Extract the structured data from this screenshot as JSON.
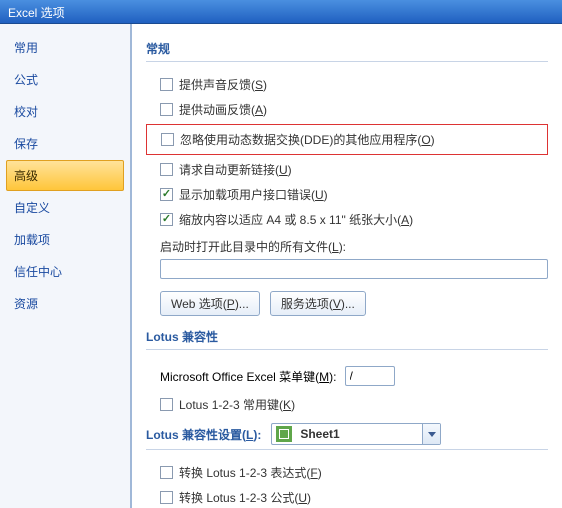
{
  "window": {
    "title": "Excel 选项"
  },
  "sidebar": {
    "items": [
      {
        "label": "常用"
      },
      {
        "label": "公式"
      },
      {
        "label": "校对"
      },
      {
        "label": "保存"
      },
      {
        "label": "高级"
      },
      {
        "label": "自定义"
      },
      {
        "label": "加载项"
      },
      {
        "label": "信任中心"
      },
      {
        "label": "资源"
      }
    ]
  },
  "general": {
    "title": "常规",
    "sound_feedback": {
      "label": "提供声音反馈(",
      "hotkey": "S",
      "suffix": ")",
      "checked": false
    },
    "anim_feedback": {
      "label": "提供动画反馈(",
      "hotkey": "A",
      "suffix": ")",
      "checked": false
    },
    "ignore_dde": {
      "label": "忽略使用动态数据交换(DDE)的其他应用程序(",
      "hotkey": "O",
      "suffix": ")",
      "checked": false
    },
    "auto_update_links": {
      "label": "请求自动更新链接(",
      "hotkey": "U",
      "suffix": ")",
      "checked": false
    },
    "addin_errors": {
      "label": "显示加载项用户接口错误(",
      "hotkey": "U",
      "suffix": ")",
      "checked": true
    },
    "scale_content": {
      "label": "缩放内容以适应 A4 或 8.5 x 11\" 纸张大小(",
      "hotkey": "A",
      "suffix": ")",
      "checked": true
    },
    "startup_label": "启动时打开此目录中的所有文件(",
    "startup_hotkey": "L",
    "startup_suffix": "):",
    "startup_value": "",
    "web_options": "Web 选项(",
    "web_options_hotkey": "P",
    "web_options_suffix": ")...",
    "service_options": "服务选项(",
    "service_options_hotkey": "V",
    "service_options_suffix": ")..."
  },
  "lotus_compat": {
    "title": "Lotus 兼容性",
    "menu_key_label": "Microsoft Office Excel 菜单键(",
    "menu_key_hotkey": "M",
    "menu_key_suffix": "):",
    "menu_key_value": "/",
    "常用键": {
      "label": "Lotus 1-2-3 常用键(",
      "hotkey": "K",
      "suffix": ")",
      "checked": false
    }
  },
  "lotus_settings": {
    "title": "Lotus 兼容性设置(",
    "title_hotkey": "L",
    "title_suffix": "):",
    "sheet_value": "Sheet1",
    "expr": {
      "label": "转换 Lotus 1-2-3 表达式(",
      "hotkey": "F",
      "suffix": ")",
      "checked": false
    },
    "formula": {
      "label": "转换 Lotus 1-2-3 公式(",
      "hotkey": "U",
      "suffix": ")",
      "checked": false
    }
  }
}
